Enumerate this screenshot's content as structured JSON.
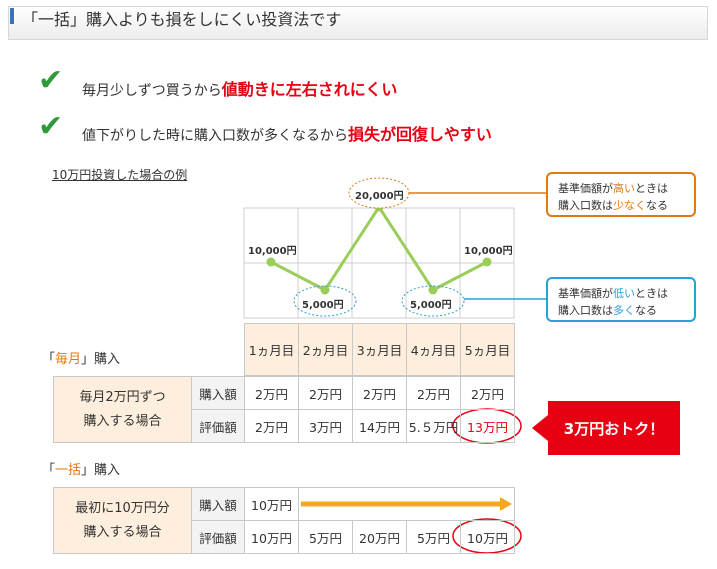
{
  "header": {
    "title": "「一括」購入よりも損をしにくい投資法です"
  },
  "bullets": [
    {
      "text": "毎月少しずつ買うから",
      "emphasis": "値動きに左右されにくい"
    },
    {
      "text": "値下がりした時に購入口数が多くなるから",
      "emphasis": "損失が回復しやすい"
    }
  ],
  "example_caption": "10万円投資した場合の例",
  "chart": {
    "price_labels": [
      "10,000円",
      "5,000円",
      "20,000円",
      "5,000円",
      "10,000円"
    ]
  },
  "callouts": {
    "high": {
      "line1_a": "基準価額が",
      "line1_hi": "高い",
      "line1_b": "ときは",
      "line2_a": "購入口数は",
      "line2_hi": "少なく",
      "line2_b": "なる"
    },
    "low": {
      "line1_a": "基準価額が",
      "line1_hi": "低い",
      "line1_b": "ときは",
      "line2_a": "購入口数は",
      "line2_hi": "多く",
      "line2_b": "なる"
    }
  },
  "months": [
    "1ヵ月目",
    "2ヵ月目",
    "3ヵ月目",
    "4ヵ月目",
    "5ヵ月目"
  ],
  "monthly": {
    "section_open": "「",
    "section_em": "毎月",
    "section_close": "」購入",
    "label_line1": "毎月2万円ずつ",
    "label_line2": "購入する場合",
    "row1_label": "購入額",
    "row1": [
      "2万円",
      "2万円",
      "2万円",
      "2万円",
      "2万円"
    ],
    "row2_label": "評価額",
    "row2": [
      "2万円",
      "3万円",
      "14万円",
      "5.５万円",
      "13万円"
    ]
  },
  "deal_text": "3万円おトク！",
  "lump": {
    "section_open": "「",
    "section_em": "一括",
    "section_close": "」購入",
    "label_line1": "最初に10万円分",
    "label_line2": "購入する場合",
    "row1_label": "購入額",
    "row1_value": "10万円",
    "row2_label": "評価額",
    "row2": [
      "10万円",
      "5万円",
      "20万円",
      "5万円",
      "10万円"
    ]
  },
  "colors": {
    "accent_red": "#e60012",
    "orange": "#e07a10",
    "blue": "#2a9fd8",
    "line_green": "#9acd5a",
    "check_green": "#2e9a3a"
  }
}
